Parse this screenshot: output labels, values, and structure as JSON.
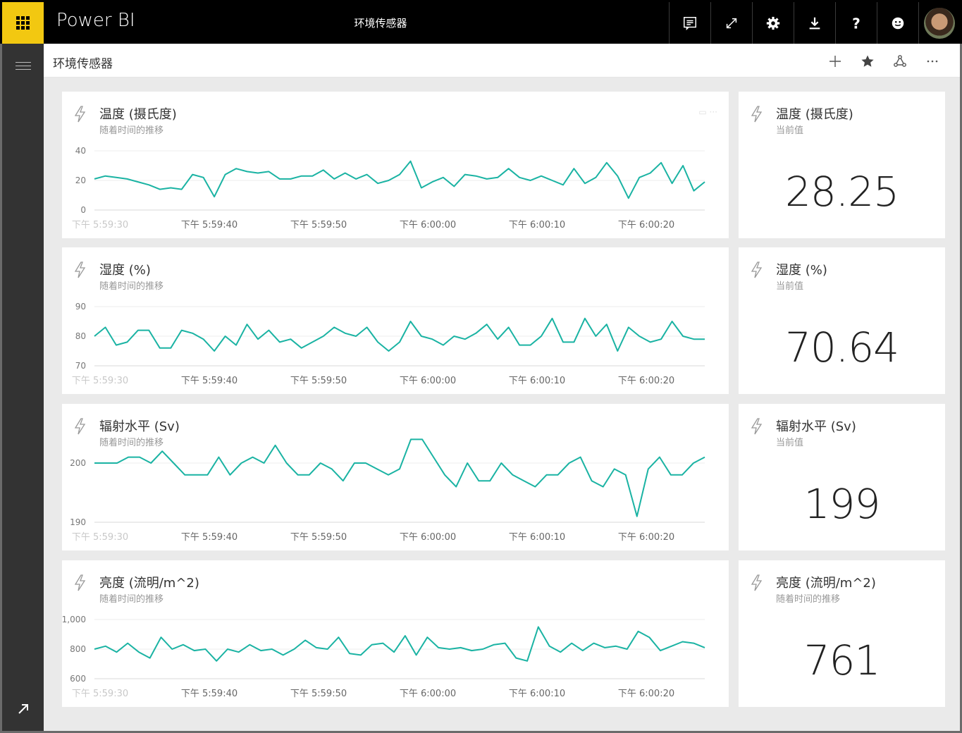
{
  "app": {
    "brand": "Power BI",
    "title": "环境传感器"
  },
  "top_actions": [
    {
      "name": "comment-icon"
    },
    {
      "name": "fullscreen-icon"
    },
    {
      "name": "settings-gear-icon"
    },
    {
      "name": "download-icon"
    },
    {
      "name": "help-icon"
    },
    {
      "name": "feedback-smiley-icon"
    }
  ],
  "dashboard": {
    "title": "环境传感器"
  },
  "x_tick_labels": [
    "下午 5:59:30",
    "下午 5:59:40",
    "下午 5:59:50",
    "下午 6:00:00",
    "下午 6:00:10",
    "下午 6:00:20"
  ],
  "line_tiles": [
    {
      "title": "温度 (摄氏度)",
      "subtitle": "随着时间的推移",
      "y_ticks": [
        "40",
        "20",
        "0"
      ]
    },
    {
      "title": "湿度 (%)",
      "subtitle": "随着时间的推移",
      "y_ticks": [
        "90",
        "80",
        "70"
      ]
    },
    {
      "title": "辐射水平 (Sv)",
      "subtitle": "随着时间的推移",
      "y_ticks": [
        "200",
        "190"
      ]
    },
    {
      "title": "亮度 (流明/m^2)",
      "subtitle": "随着时间的推移",
      "y_ticks": [
        "1,000",
        "800",
        "600"
      ]
    }
  ],
  "card_tiles": [
    {
      "title": "温度 (摄氏度)",
      "subtitle": "当前值",
      "value": "28.25"
    },
    {
      "title": "湿度 (%)",
      "subtitle": "当前值",
      "value": "70.64"
    },
    {
      "title": "辐射水平 (Sv)",
      "subtitle": "当前值",
      "value": "199"
    },
    {
      "title": "亮度 (流明/m^2)",
      "subtitle": "随着时间的推移",
      "value": "761"
    }
  ],
  "colors": {
    "accent_yellow": "#f2c811",
    "line": "#1ab3a3",
    "topbar": "#000000",
    "rail": "#333333",
    "canvas": "#eaeaea"
  },
  "chart_data": [
    {
      "type": "line",
      "title": "温度 (摄氏度)",
      "subtitle": "随着时间的推移",
      "x_tick_labels": [
        "下午 5:59:30",
        "下午 5:59:40",
        "下午 5:59:50",
        "下午 6:00:00",
        "下午 6:00:10",
        "下午 6:00:20"
      ],
      "ylim": [
        0,
        40
      ],
      "y_ticks": [
        0,
        20,
        40
      ],
      "values": [
        21,
        23,
        22,
        21,
        19,
        17,
        14,
        15,
        14,
        24,
        22,
        9,
        24,
        28,
        26,
        25,
        26,
        21,
        21,
        23,
        23,
        27,
        21,
        25,
        21,
        24,
        18,
        20,
        24,
        33,
        15,
        19,
        22,
        16,
        24,
        23,
        21,
        22,
        28,
        22,
        20,
        23,
        20,
        17,
        28,
        18,
        22,
        32,
        23,
        8,
        22,
        25,
        32,
        18,
        30,
        13,
        19
      ],
      "grid": true
    },
    {
      "type": "line",
      "title": "湿度 (%)",
      "subtitle": "随着时间的推移",
      "x_tick_labels": [
        "下午 5:59:30",
        "下午 5:59:40",
        "下午 5:59:50",
        "下午 6:00:00",
        "下午 6:00:10",
        "下午 6:00:20"
      ],
      "ylim": [
        70,
        90
      ],
      "y_ticks": [
        70,
        80,
        90
      ],
      "values": [
        80,
        83,
        77,
        78,
        82,
        82,
        76,
        76,
        82,
        81,
        79,
        75,
        80,
        77,
        84,
        79,
        82,
        78,
        79,
        76,
        78,
        80,
        83,
        81,
        80,
        83,
        78,
        75,
        78,
        85,
        80,
        79,
        77,
        80,
        79,
        81,
        84,
        79,
        83,
        77,
        77,
        80,
        86,
        78,
        78,
        86,
        80,
        84,
        75,
        83,
        80,
        78,
        79,
        85,
        80,
        79,
        79
      ],
      "grid": true
    },
    {
      "type": "line",
      "title": "辐射水平 (Sv)",
      "subtitle": "随着时间的推移",
      "x_tick_labels": [
        "下午 5:59:30",
        "下午 5:59:40",
        "下午 5:59:50",
        "下午 6:00:00",
        "下午 6:00:10",
        "下午 6:00:20"
      ],
      "ylim": [
        190,
        200
      ],
      "y_ticks": [
        190,
        200
      ],
      "values": [
        200,
        200,
        200,
        201,
        201,
        200,
        202,
        200,
        198,
        198,
        198,
        201,
        198,
        200,
        201,
        200,
        203,
        200,
        198,
        198,
        200,
        199,
        197,
        200,
        200,
        199,
        198,
        199,
        204,
        204,
        201,
        198,
        196,
        200,
        197,
        197,
        200,
        198,
        197,
        196,
        198,
        198,
        200,
        201,
        197,
        196,
        199,
        198,
        191,
        199,
        201,
        198,
        198,
        200,
        201
      ],
      "grid": true
    },
    {
      "type": "line",
      "title": "亮度 (流明/m^2)",
      "subtitle": "随着时间的推移",
      "x_tick_labels": [
        "下午 5:59:30",
        "下午 5:59:40",
        "下午 5:59:50",
        "下午 6:00:00",
        "下午 6:00:10",
        "下午 6:00:20"
      ],
      "ylim": [
        600,
        1000
      ],
      "y_ticks": [
        600,
        800,
        1000
      ],
      "values": [
        800,
        820,
        780,
        840,
        780,
        740,
        880,
        800,
        830,
        790,
        800,
        720,
        800,
        780,
        830,
        790,
        800,
        760,
        800,
        860,
        810,
        800,
        880,
        770,
        760,
        830,
        840,
        780,
        890,
        760,
        880,
        810,
        800,
        810,
        790,
        800,
        830,
        840,
        740,
        720,
        950,
        820,
        780,
        840,
        790,
        840,
        810,
        820,
        800,
        920,
        880,
        790,
        820,
        850,
        840,
        810
      ],
      "grid": true
    }
  ]
}
